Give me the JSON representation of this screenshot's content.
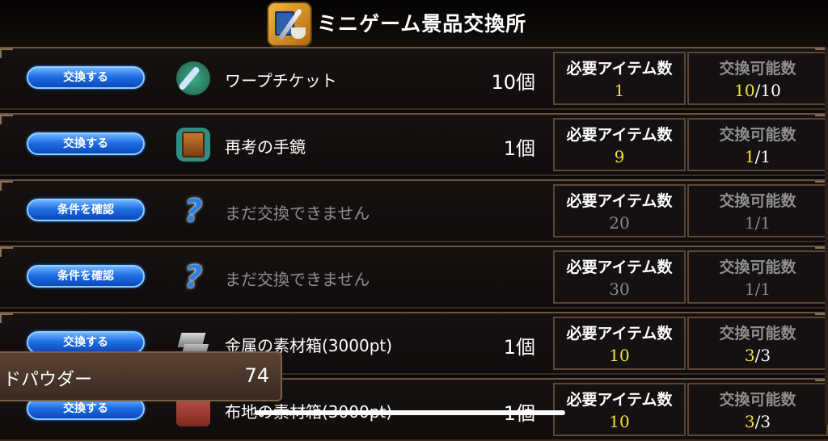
{
  "header": {
    "title": "ミニゲーム景品交換所",
    "icon": "shop-icon"
  },
  "labels": {
    "required": "必要アイテム数",
    "available": "交換可能数"
  },
  "rows": [
    {
      "button": "交換する",
      "icon": "ticket-icon",
      "name": "ワープチケット",
      "quantity": "10個",
      "required": "1",
      "avail_current": "10",
      "avail_total": "10",
      "enabled": true
    },
    {
      "button": "交換する",
      "icon": "book-icon",
      "name": "再考の手鏡",
      "quantity": "1個",
      "required": "9",
      "avail_current": "1",
      "avail_total": "1",
      "enabled": true
    },
    {
      "button": "条件を確認",
      "icon": "question-icon",
      "name": "まだ交換できません",
      "quantity": "",
      "required": "20",
      "avail_current": "1",
      "avail_total": "1",
      "enabled": false
    },
    {
      "button": "条件を確認",
      "icon": "question-icon",
      "name": "まだ交換できません",
      "quantity": "",
      "required": "30",
      "avail_current": "1",
      "avail_total": "1",
      "enabled": false
    },
    {
      "button": "交換する",
      "icon": "metal-box-icon",
      "name": "金属の素材箱(3000pt)",
      "quantity": "1個",
      "required": "10",
      "avail_current": "3",
      "avail_total": "3",
      "enabled": true
    },
    {
      "button": "交換する",
      "icon": "cloth-box-icon",
      "name": "布地の素材箱(3000pt)",
      "quantity": "1個",
      "required": "10",
      "avail_current": "3",
      "avail_total": "3",
      "enabled": true
    }
  ],
  "currency": {
    "name": "ドパウダー",
    "count": "74"
  },
  "colors": {
    "accent_yellow": "#f3e33c",
    "button_blue": "#1f6fe6",
    "frame": "#6a5442"
  }
}
